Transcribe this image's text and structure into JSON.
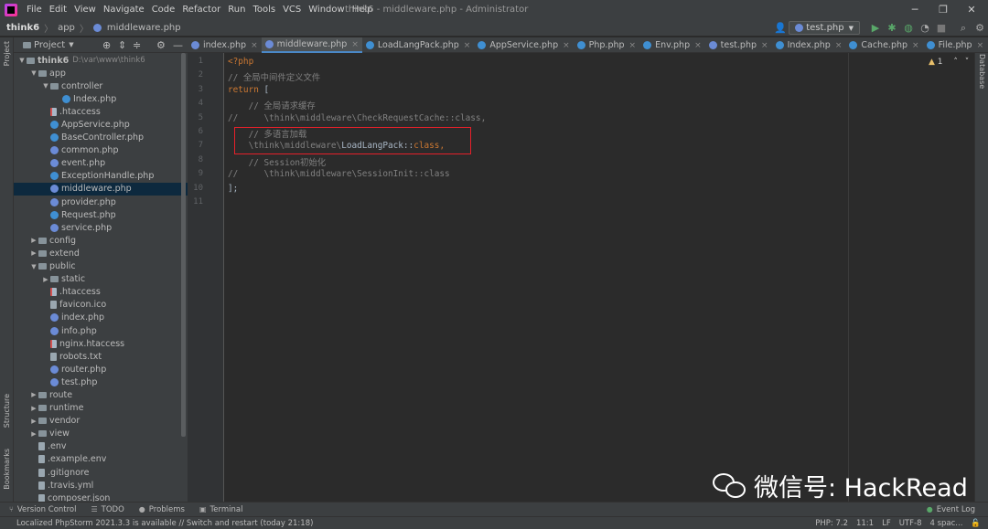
{
  "menubar": {
    "items": [
      "File",
      "Edit",
      "View",
      "Navigate",
      "Code",
      "Refactor",
      "Run",
      "Tools",
      "VCS",
      "Window",
      "Help"
    ],
    "title": "think6 - middleware.php - Administrator"
  },
  "navbar": {
    "project": "think6",
    "folder": "app",
    "file": "middleware.php",
    "run_config": "test.php"
  },
  "sidebar": {
    "left_tool": "Project",
    "structure": "Structure",
    "bookmarks": "Bookmarks",
    "right_tool": "Database"
  },
  "project_panel": {
    "title": "Project",
    "tree": [
      {
        "label": "think6",
        "path": "D:\\var\\www\\think6",
        "depth": 0,
        "type": "folder",
        "open": true
      },
      {
        "label": "app",
        "depth": 1,
        "type": "folder",
        "open": true
      },
      {
        "label": "controller",
        "depth": 2,
        "type": "folder",
        "open": true
      },
      {
        "label": "Index.php",
        "depth": 3,
        "type": "cphp"
      },
      {
        "label": ".htaccess",
        "depth": 2,
        "type": "htac"
      },
      {
        "label": "AppService.php",
        "depth": 2,
        "type": "cphp"
      },
      {
        "label": "BaseController.php",
        "depth": 2,
        "type": "cphp"
      },
      {
        "label": "common.php",
        "depth": 2,
        "type": "php"
      },
      {
        "label": "event.php",
        "depth": 2,
        "type": "php"
      },
      {
        "label": "ExceptionHandle.php",
        "depth": 2,
        "type": "cphp"
      },
      {
        "label": "middleware.php",
        "depth": 2,
        "type": "php",
        "selected": true
      },
      {
        "label": "provider.php",
        "depth": 2,
        "type": "php"
      },
      {
        "label": "Request.php",
        "depth": 2,
        "type": "cphp"
      },
      {
        "label": "service.php",
        "depth": 2,
        "type": "php"
      },
      {
        "label": "config",
        "depth": 1,
        "type": "folder",
        "open": false
      },
      {
        "label": "extend",
        "depth": 1,
        "type": "folder",
        "open": false
      },
      {
        "label": "public",
        "depth": 1,
        "type": "folder",
        "open": true
      },
      {
        "label": "static",
        "depth": 2,
        "type": "folder",
        "open": false
      },
      {
        "label": ".htaccess",
        "depth": 2,
        "type": "htac"
      },
      {
        "label": "favicon.ico",
        "depth": 2,
        "type": "file"
      },
      {
        "label": "index.php",
        "depth": 2,
        "type": "php"
      },
      {
        "label": "info.php",
        "depth": 2,
        "type": "php"
      },
      {
        "label": "nginx.htaccess",
        "depth": 2,
        "type": "htac"
      },
      {
        "label": "robots.txt",
        "depth": 2,
        "type": "file"
      },
      {
        "label": "router.php",
        "depth": 2,
        "type": "php"
      },
      {
        "label": "test.php",
        "depth": 2,
        "type": "php"
      },
      {
        "label": "route",
        "depth": 1,
        "type": "folder",
        "open": false
      },
      {
        "label": "runtime",
        "depth": 1,
        "type": "folder",
        "open": false
      },
      {
        "label": "vendor",
        "depth": 1,
        "type": "folder",
        "open": false
      },
      {
        "label": "view",
        "depth": 1,
        "type": "folder",
        "open": false
      },
      {
        "label": ".env",
        "depth": 1,
        "type": "file"
      },
      {
        "label": ".example.env",
        "depth": 1,
        "type": "file"
      },
      {
        "label": ".gitignore",
        "depth": 1,
        "type": "file"
      },
      {
        "label": ".travis.yml",
        "depth": 1,
        "type": "file"
      },
      {
        "label": "composer.json",
        "depth": 1,
        "type": "file"
      }
    ]
  },
  "tabs": [
    {
      "label": "index.php",
      "color": "#6b8bd6"
    },
    {
      "label": "middleware.php",
      "color": "#6b8bd6",
      "active": true
    },
    {
      "label": "LoadLangPack.php",
      "color": "#3f8fd2"
    },
    {
      "label": "AppService.php",
      "color": "#3f8fd2"
    },
    {
      "label": "Php.php",
      "color": "#3f8fd2"
    },
    {
      "label": "Env.php",
      "color": "#3f8fd2"
    },
    {
      "label": "test.php",
      "color": "#6b8bd6"
    },
    {
      "label": "Index.php",
      "color": "#3f8fd2"
    },
    {
      "label": "Cache.php",
      "color": "#3f8fd2"
    },
    {
      "label": "File.php",
      "color": "#3f8fd2"
    }
  ],
  "editor": {
    "line_numbers": [
      "1",
      "2",
      "3",
      "4",
      "5",
      "6",
      "7",
      "8",
      "9",
      "10",
      "11"
    ],
    "inspection": "1",
    "lines": [
      [
        {
          "t": "<?php",
          "c": "k-php"
        }
      ],
      [
        {
          "t": "// 全局中间件定义文件",
          "c": "k-cmt-dim"
        }
      ],
      [
        {
          "t": "return",
          "c": "k-kw"
        },
        {
          "t": " [",
          "c": "k-op"
        }
      ],
      [
        {
          "t": "    // 全局请求缓存",
          "c": "k-cmt-dim"
        }
      ],
      [
        {
          "t": "//     \\think\\middleware\\CheckRequestCache::class,",
          "c": "k-cmt-dim"
        }
      ],
      [
        {
          "t": "    // 多语言加载",
          "c": "k-cmt-dim"
        }
      ],
      [
        {
          "t": "    \\think\\middleware\\",
          "c": "k-cmt-dim"
        },
        {
          "t": "LoadLangPack",
          "c": "k-cls"
        },
        {
          "t": "::",
          "c": "k-op"
        },
        {
          "t": "class",
          "c": "k-kw"
        },
        {
          "t": ",",
          "c": "k-kw"
        }
      ],
      [
        {
          "t": "    // Session初始化",
          "c": "k-cmt-dim"
        }
      ],
      [
        {
          "t": "//     \\think\\middleware\\SessionInit::class",
          "c": "k-cmt-dim"
        }
      ],
      [
        {
          "t": "];",
          "c": "k-op"
        }
      ],
      [
        {
          "t": "",
          "c": "k-op"
        }
      ]
    ]
  },
  "watermark": "微信号: HackRead",
  "bottom_tools": {
    "version_control": "Version Control",
    "todo": "TODO",
    "problems": "Problems",
    "terminal": "Terminal",
    "event_log": "Event Log"
  },
  "status": {
    "message": "Localized PhpStorm 2021.3.3 is available // Switch and restart (today 21:18)",
    "php": "PHP: 7.2",
    "position": "11:1",
    "line_sep": "LF",
    "encoding": "UTF-8",
    "indent": "4 spac..."
  },
  "colors": {
    "accent": "#4a88c7",
    "highlight_box": "#e5202a",
    "run": "#59a869"
  }
}
